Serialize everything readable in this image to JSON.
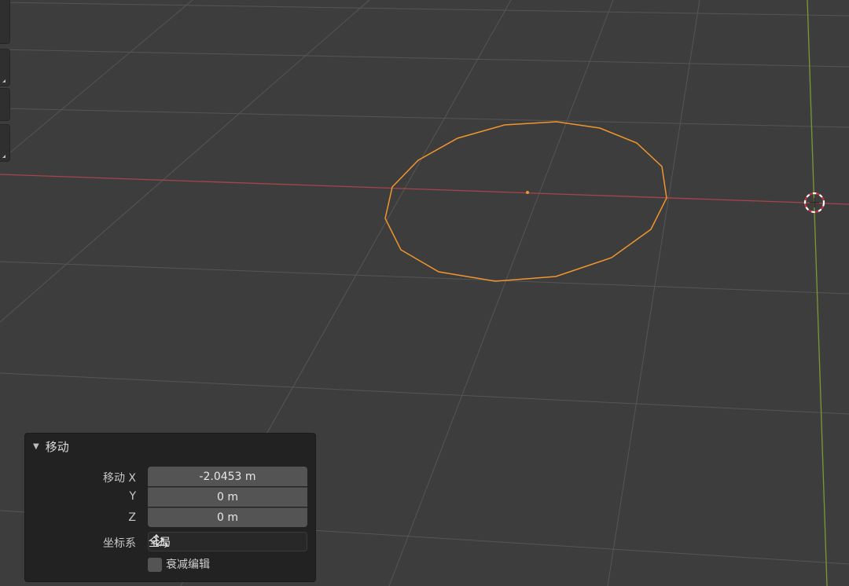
{
  "operator_panel": {
    "title": "移动",
    "move_x_label": "移动 X",
    "y_label": "Y",
    "z_label": "Z",
    "x_value": "-2.0453 m",
    "y_value": "0 m",
    "z_value": "0 m",
    "orientation_label": "坐标系",
    "orientation_value": "全局",
    "proportional_edit_label": "衰减编辑",
    "proportional_edit_checked": false
  },
  "colors": {
    "viewport_bg": "#3d3d3d",
    "grid_line": "#555555",
    "x_axis": "#a8444c",
    "y_axis": "#7a9a30",
    "selection": "#f0962c",
    "panel_bg": "#222222",
    "field_bg": "#545454"
  },
  "icons": {
    "header_toggle": "disclosure-triangle-down-icon",
    "orientation": "global-axes-icon",
    "dropdown": "chevron-down-icon",
    "cursor": "3d-cursor-icon"
  }
}
